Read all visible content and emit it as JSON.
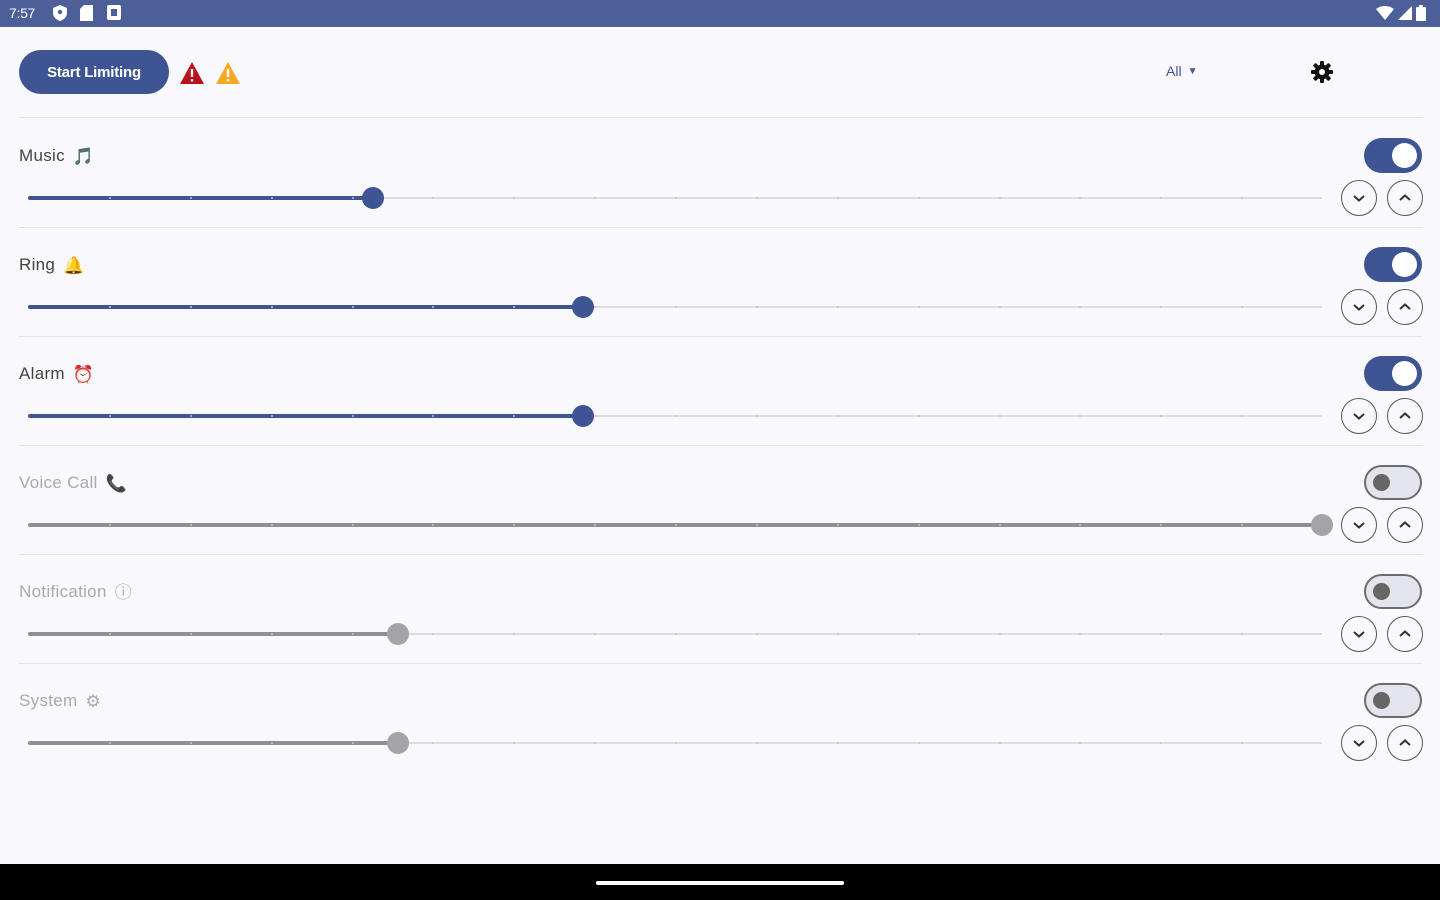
{
  "status_bar": {
    "time": "7:57",
    "left_icons": [
      "shield-icon",
      "sd-card-icon",
      "screenshot-icon"
    ],
    "right_icons": [
      "wifi-icon",
      "cell-signal-icon",
      "battery-icon"
    ]
  },
  "toolbar": {
    "start_label": "Start Limiting",
    "warning_icons": [
      "error-warning-icon",
      "caution-warning-icon"
    ],
    "filter_label": "All",
    "filter_arrow": "▼",
    "settings_icon": "gear-icon"
  },
  "colors": {
    "accent": "#3f5593",
    "status_bar": "#4c5f98",
    "background": "#f8f8fd",
    "disabled_track": "#8f8f94",
    "warning_red": "#b8141a",
    "warning_amber": "#f4a922"
  },
  "streams": [
    {
      "id": "music",
      "label": "Music",
      "icon": "🎵",
      "enabled": true,
      "level": 0.267
    },
    {
      "id": "ring",
      "label": "Ring",
      "icon": "🔔",
      "enabled": true,
      "level": 0.429
    },
    {
      "id": "alarm",
      "label": "Alarm",
      "icon": "⏰",
      "enabled": true,
      "level": 0.429
    },
    {
      "id": "voice_call",
      "label": "Voice Call",
      "icon": "📞",
      "enabled": false,
      "level": 1.0
    },
    {
      "id": "notification",
      "label": "Notification",
      "icon": "ⓘ",
      "enabled": false,
      "level": 0.286
    },
    {
      "id": "system",
      "label": "System",
      "icon": "⚙",
      "enabled": false,
      "level": 0.286
    }
  ]
}
